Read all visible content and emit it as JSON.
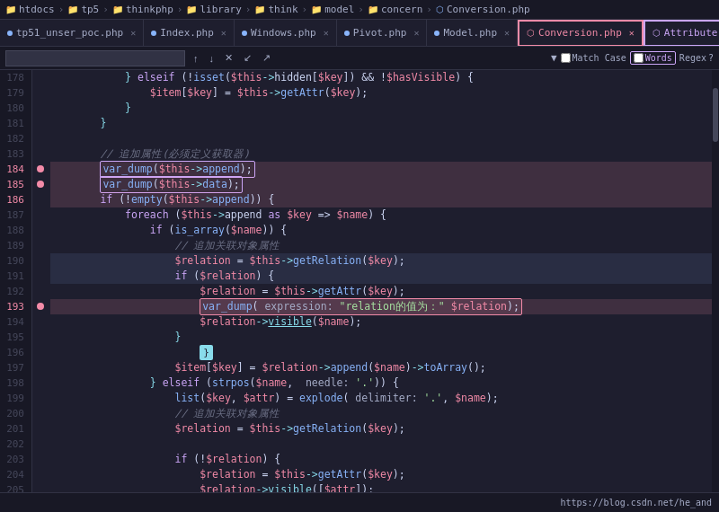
{
  "breadcrumb": {
    "items": [
      {
        "label": "htdocs",
        "icon": "folder"
      },
      {
        "label": "tp5",
        "icon": "folder"
      },
      {
        "label": "thinkphp",
        "icon": "folder"
      },
      {
        "label": "library",
        "icon": "folder"
      },
      {
        "label": "think",
        "icon": "folder"
      },
      {
        "label": "model",
        "icon": "folder"
      },
      {
        "label": "concern",
        "icon": "folder"
      },
      {
        "label": "Conversion.php",
        "icon": "php"
      }
    ]
  },
  "tabs": [
    {
      "label": "tp51_unser_poc.php",
      "icon": "php",
      "active": false,
      "modified": true
    },
    {
      "label": "Index.php",
      "icon": "php",
      "active": false,
      "modified": false
    },
    {
      "label": "Windows.php",
      "icon": "php",
      "active": false,
      "modified": false
    },
    {
      "label": "Pivot.php",
      "icon": "php",
      "active": false,
      "modified": false
    },
    {
      "label": "Model.php",
      "icon": "php",
      "active": false,
      "modified": false
    },
    {
      "label": "Conversion.php",
      "icon": "php",
      "active": true,
      "modified": false
    },
    {
      "label": "Attribute",
      "icon": "php",
      "active": false,
      "modified": false
    }
  ],
  "search": {
    "placeholder": "",
    "value": "",
    "options": {
      "match_case_label": "Match Case",
      "words_label": "Words",
      "regex_label": "Regex"
    }
  },
  "status_bar": {
    "text": "https://blog.csdn.net/he_and"
  },
  "lines": [
    {
      "num": 178,
      "code": "            } elseif (!isset($this->hidden[$key]) && !$hasVisible) {"
    },
    {
      "num": 179,
      "code": "                $item[$key] = $this->getAttr($key);"
    },
    {
      "num": 180,
      "code": "            }"
    },
    {
      "num": 181,
      "code": "        }"
    },
    {
      "num": 182,
      "code": ""
    },
    {
      "num": 183,
      "code": "        // 追加属性(必须定义获取器)"
    },
    {
      "num": 184,
      "code": "        var_dump($this->append);",
      "breakpoint": true,
      "highlight": "red"
    },
    {
      "num": 185,
      "code": "        var_dump($this->data);",
      "breakpoint": true,
      "highlight": "red"
    },
    {
      "num": 186,
      "code": "        if (!empty($this->append)) {",
      "highlight": "red"
    },
    {
      "num": 187,
      "code": "            foreach ($this->append as $key => $name) {"
    },
    {
      "num": 188,
      "code": "                if (is_array($name)) {"
    },
    {
      "num": 189,
      "code": "                    // 追加关联对象属性"
    },
    {
      "num": 190,
      "code": "                    $relation = $this->getRelation($key);",
      "highlight": "blue"
    },
    {
      "num": 191,
      "code": "                    if ($relation) {",
      "highlight": "blue"
    },
    {
      "num": 192,
      "code": "                        $relation = $this->getAttr($key);"
    },
    {
      "num": 193,
      "code": "                        var_dump( expression: \"relation的值为：\" $relation);",
      "breakpoint": true,
      "highlight": "search"
    },
    {
      "num": 194,
      "code": "                        $relation->visible($name);"
    },
    {
      "num": 195,
      "code": "                    }"
    },
    {
      "num": 196,
      "code": ""
    },
    {
      "num": 197,
      "code": "                    $item[$key] = $relation->append($name)->toArray();"
    },
    {
      "num": 198,
      "code": "                } elseif (strpos($name,  needle: '.')) {"
    },
    {
      "num": 199,
      "code": "                    list($key, $attr) = explode( delimiter: '.', $name);"
    },
    {
      "num": 200,
      "code": "                    // 追加关联对象属性"
    },
    {
      "num": 201,
      "code": "                    $relation = $this->getRelation($key);"
    },
    {
      "num": 202,
      "code": ""
    },
    {
      "num": 203,
      "code": "                    if (!$relation) {"
    },
    {
      "num": 204,
      "code": "                        $relation = $this->getAttr($key);"
    },
    {
      "num": 205,
      "code": "                        $relation->visible([$attr]);"
    }
  ]
}
